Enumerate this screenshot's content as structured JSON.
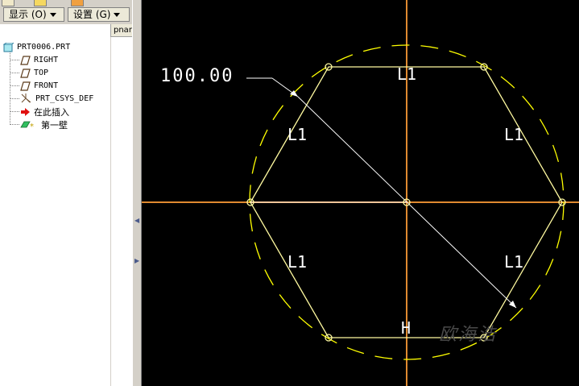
{
  "toolbar": {
    "show_label": "显示 (O)",
    "settings_label": "设置 (G)"
  },
  "column_header": "pnar",
  "tree": {
    "items": [
      {
        "label": "PRT0006.PRT",
        "icon": "part-icon"
      },
      {
        "label": "RIGHT",
        "icon": "datum-plane-icon"
      },
      {
        "label": "TOP",
        "icon": "datum-plane-icon"
      },
      {
        "label": "FRONT",
        "icon": "datum-plane-icon"
      },
      {
        "label": "PRT_CSYS_DEF",
        "icon": "coordinate-system-icon"
      },
      {
        "label": "在此插入",
        "icon": "insert-here-arrow-icon"
      },
      {
        "label": "第一壁",
        "icon": "first-wall-feature-icon"
      }
    ]
  },
  "sketch": {
    "dimension_text": "100.00",
    "constraint_labels": [
      "L1",
      "L1",
      "L1",
      "L1",
      "L1"
    ],
    "horizontal_label": "H",
    "watermark_text": "欧海浩",
    "colors": {
      "background": "#000000",
      "geometry": "#fffaa0",
      "construction_circle": "#ffff00",
      "centerline": "#e08a30",
      "dimension": "#ffffff"
    }
  }
}
